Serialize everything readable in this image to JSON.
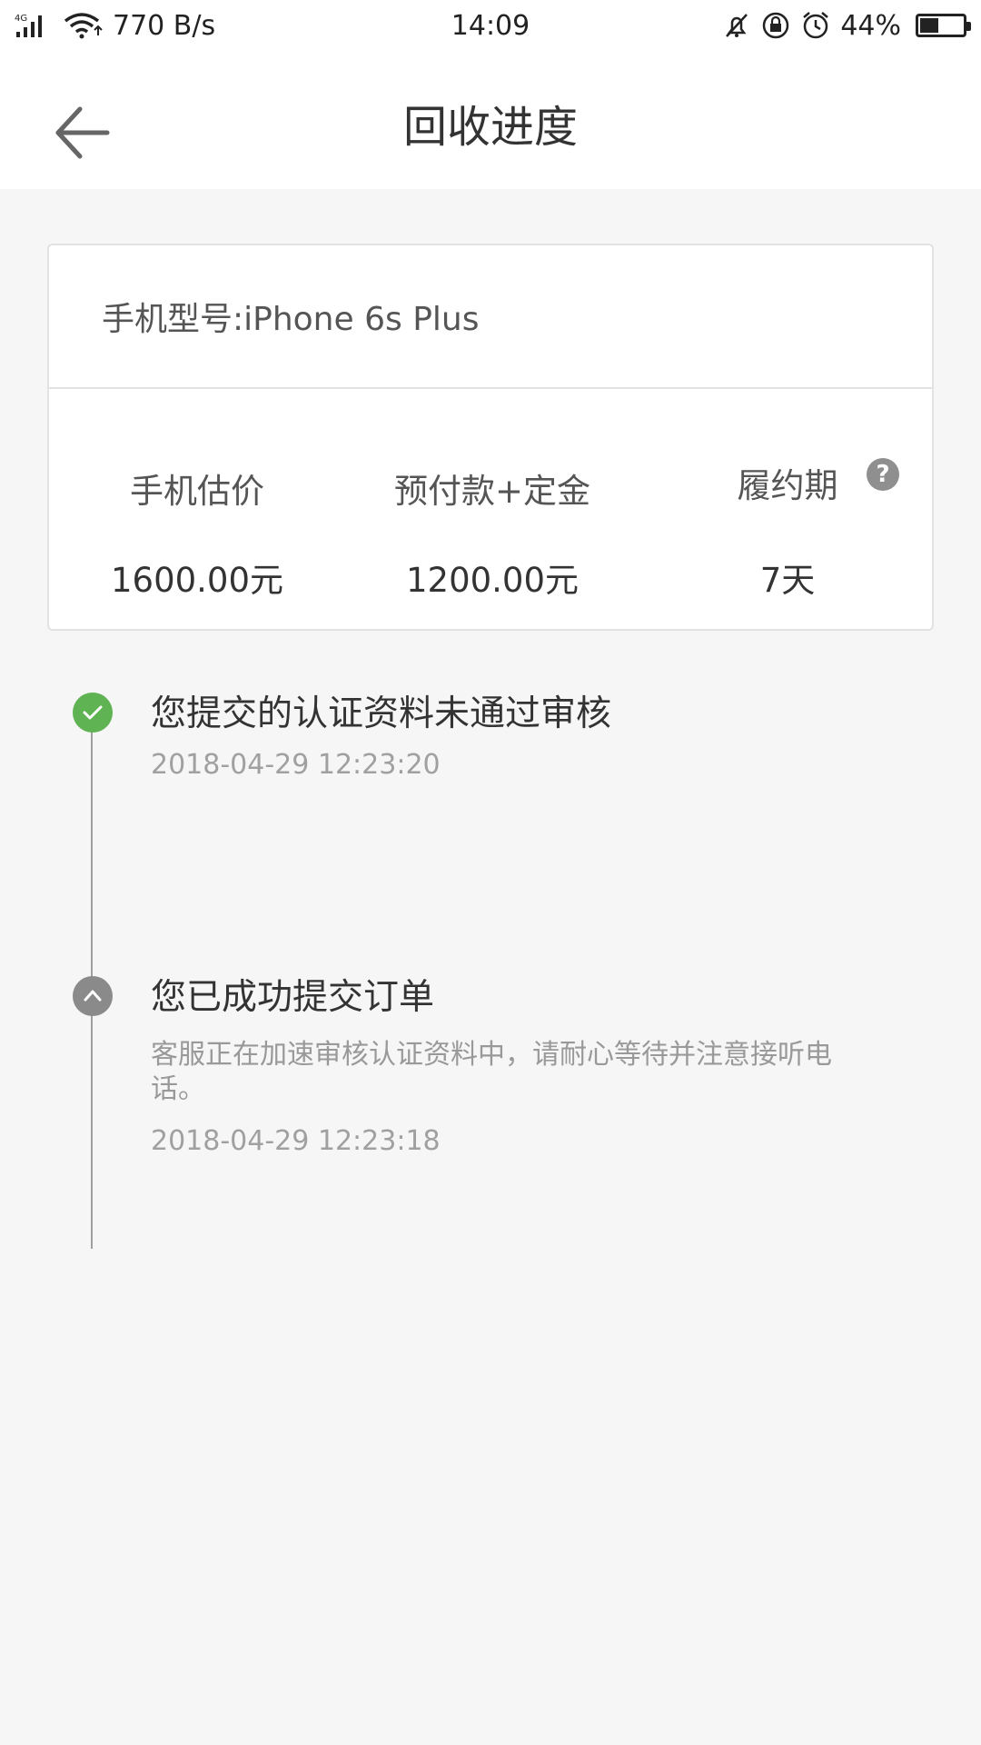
{
  "status_bar": {
    "network": "4G",
    "speed": "770 B/s",
    "time": "14:09",
    "battery": "44%",
    "battery_level": 0.44
  },
  "header": {
    "title": "回收进度"
  },
  "card": {
    "model": "手机型号:iPhone 6s Plus",
    "metrics": [
      {
        "label": "手机估价",
        "value": "1600.00元"
      },
      {
        "label": "预付款+定金",
        "value": "1200.00元"
      },
      {
        "label": "履约期",
        "value": "7天"
      }
    ],
    "help_symbol": "?"
  },
  "timeline": [
    {
      "title": "您提交的认证资料未通过审核",
      "time": "2018-04-29 12:23:20",
      "status_icon": "check-icon"
    },
    {
      "title": "您已成功提交订单",
      "description": "客服正在加速审核认证资料中，请耐心等待并注意接听电话。",
      "time": "2018-04-29 12:23:18",
      "status_icon": "chevron-up-icon"
    }
  ],
  "colors": {
    "accent_green": "#5fb352",
    "pending_gray": "#8a8a8a",
    "background": "#f6f6f6"
  }
}
